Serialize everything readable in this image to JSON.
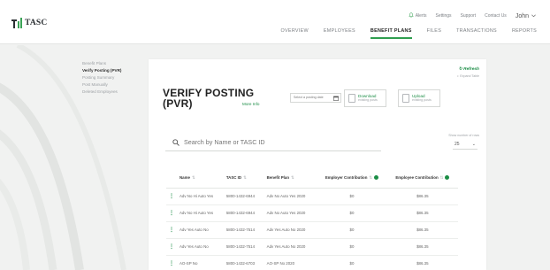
{
  "header": {
    "logo_text": "TASC",
    "utility": {
      "alerts": "Alerts",
      "settings": "Settings",
      "support": "Support",
      "contact": "Contact Us",
      "user": "John"
    },
    "nav": [
      "OVERVIEW",
      "EMPLOYEES",
      "BENEFIT PLANS",
      "FILES",
      "TRANSACTIONS",
      "REPORTS"
    ],
    "active_nav": "BENEFIT PLANS"
  },
  "side_menu": {
    "items": [
      "Benefit Plans",
      "Verify Posting (PVR)",
      "Posting Summary",
      "Post Manually",
      "Deleted Employees"
    ],
    "current": "Verify Posting (PVR)"
  },
  "card": {
    "refresh": "Refresh",
    "expand": "Expand Table",
    "title_line1": "VERIFY POSTING",
    "title_line2": "(PVR)",
    "more_info": "More Info",
    "date_placeholder": "Select a posting date",
    "download": {
      "label": "Download",
      "sub": "existing posts"
    },
    "upload": {
      "label": "Upload",
      "sub": "existing posts"
    },
    "search_placeholder": "Search by Name or TASC ID",
    "rows_label": "Show number of rows",
    "rows_value": "25"
  },
  "table": {
    "columns": [
      "Name",
      "TASC ID",
      "Benefit Plan",
      "Employer Contribution",
      "Employee Contribution"
    ],
    "rows": [
      [
        "Adv No Hi Auto Yes",
        "5800-1432-6944",
        "Adv No Auto Yes 2020",
        "$0",
        "$86.35"
      ],
      [
        "Adv No Hi Auto Yes",
        "5800-1432-6944",
        "Adv No Auto Yes 2020",
        "$0",
        "$86.35"
      ],
      [
        "Adv Yes Auto No",
        "5800-1432-7514",
        "Adv Yes Auto No 2020",
        "$0",
        "$86.35"
      ],
      [
        "Adv Yes Auto No",
        "5800-1432-7514",
        "Adv Yes Auto No 2020",
        "$0",
        "$86.35"
      ],
      [
        "AO-SP No",
        "5800-1432-6703",
        "AO-SP No 2020",
        "$0",
        "$86.35"
      ]
    ]
  },
  "colors": {
    "accent": "#1c8d46",
    "background": "#f1f2f1"
  }
}
